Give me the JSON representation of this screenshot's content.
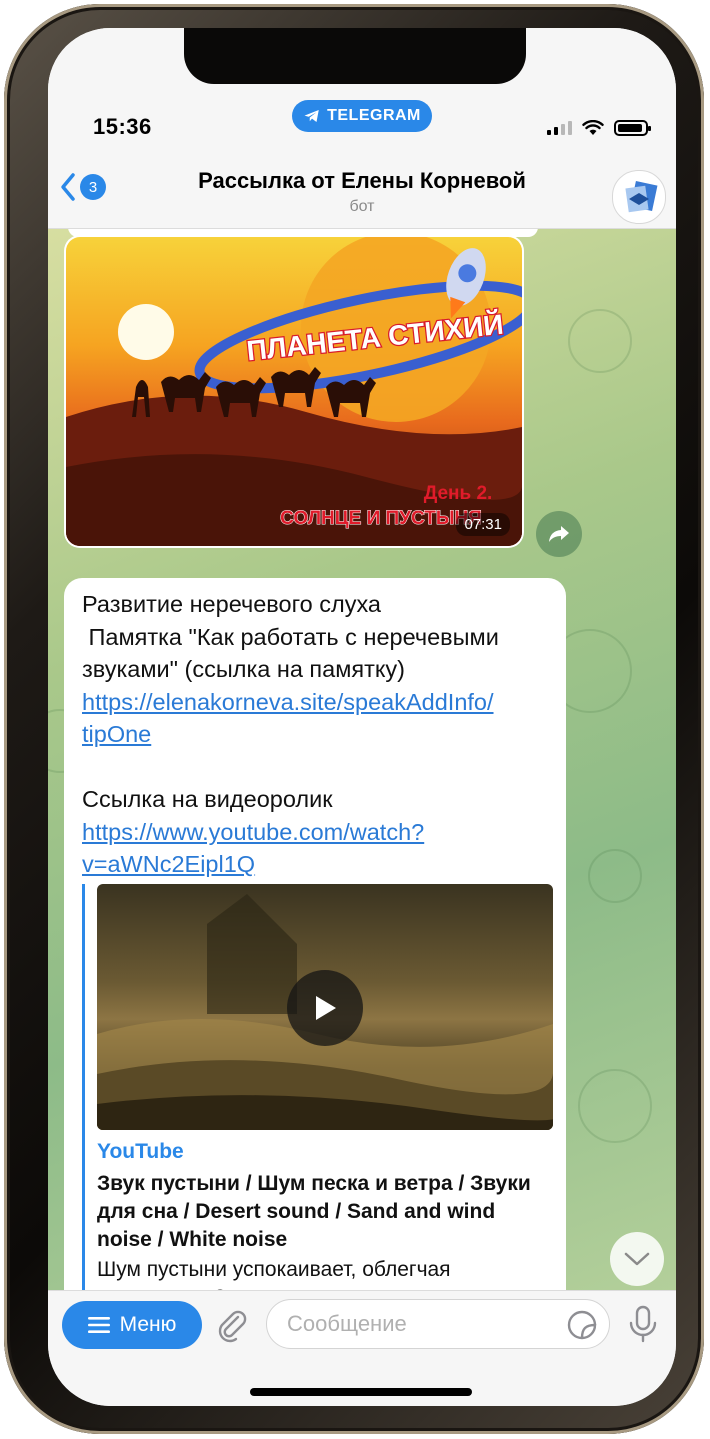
{
  "status_bar": {
    "time": "15:36",
    "app_pill": "TELEGRAM"
  },
  "header": {
    "back_badge": "3",
    "title": "Рассылка от Елены Корневой",
    "subtitle": "бот"
  },
  "video_message": {
    "duration": "07:31",
    "thumb_title": "ПЛАНЕТА СТИХИЙ",
    "thumb_day": "День 2.",
    "thumb_subtitle": "СОЛНЦЕ И ПУСТЫНЯ"
  },
  "text_message": {
    "line1": "Развитие неречевого слуха",
    "line2": " Памятка \"Как работать с неречевыми",
    "line3": "звуками\" (ссылка на памятку)",
    "link1_part1": "https://elenakorneva.site/speakAddInfo/",
    "link1_part2": "tipOne",
    "line_video": "Ссылка на видеоролик",
    "link2_part1": "https://www.youtube.com/watch?",
    "link2_part2": "v=aWNc2Eipl1Q"
  },
  "link_preview": {
    "site": "YouTube",
    "title": "Звук пустыни / Шум песка и ветра / Звуки для сна / Desert sound / Sand and wind noise / White noise",
    "description": "Шум пустыни успокаивает, облегчая засыпание. Звук пустыни называется"
  },
  "input_bar": {
    "menu_label": "Меню",
    "placeholder": "Сообщение"
  },
  "colors": {
    "accent": "#2a88e8",
    "link": "#2a7ad6",
    "chat_bg": "#a9c88a"
  },
  "icons": [
    "telegram-icon",
    "signal-icon",
    "wifi-icon",
    "battery-icon",
    "back-chevron-icon",
    "forward-icon",
    "play-icon",
    "chevron-down-icon",
    "menu-icon",
    "paperclip-icon",
    "sticker-icon",
    "microphone-icon"
  ]
}
